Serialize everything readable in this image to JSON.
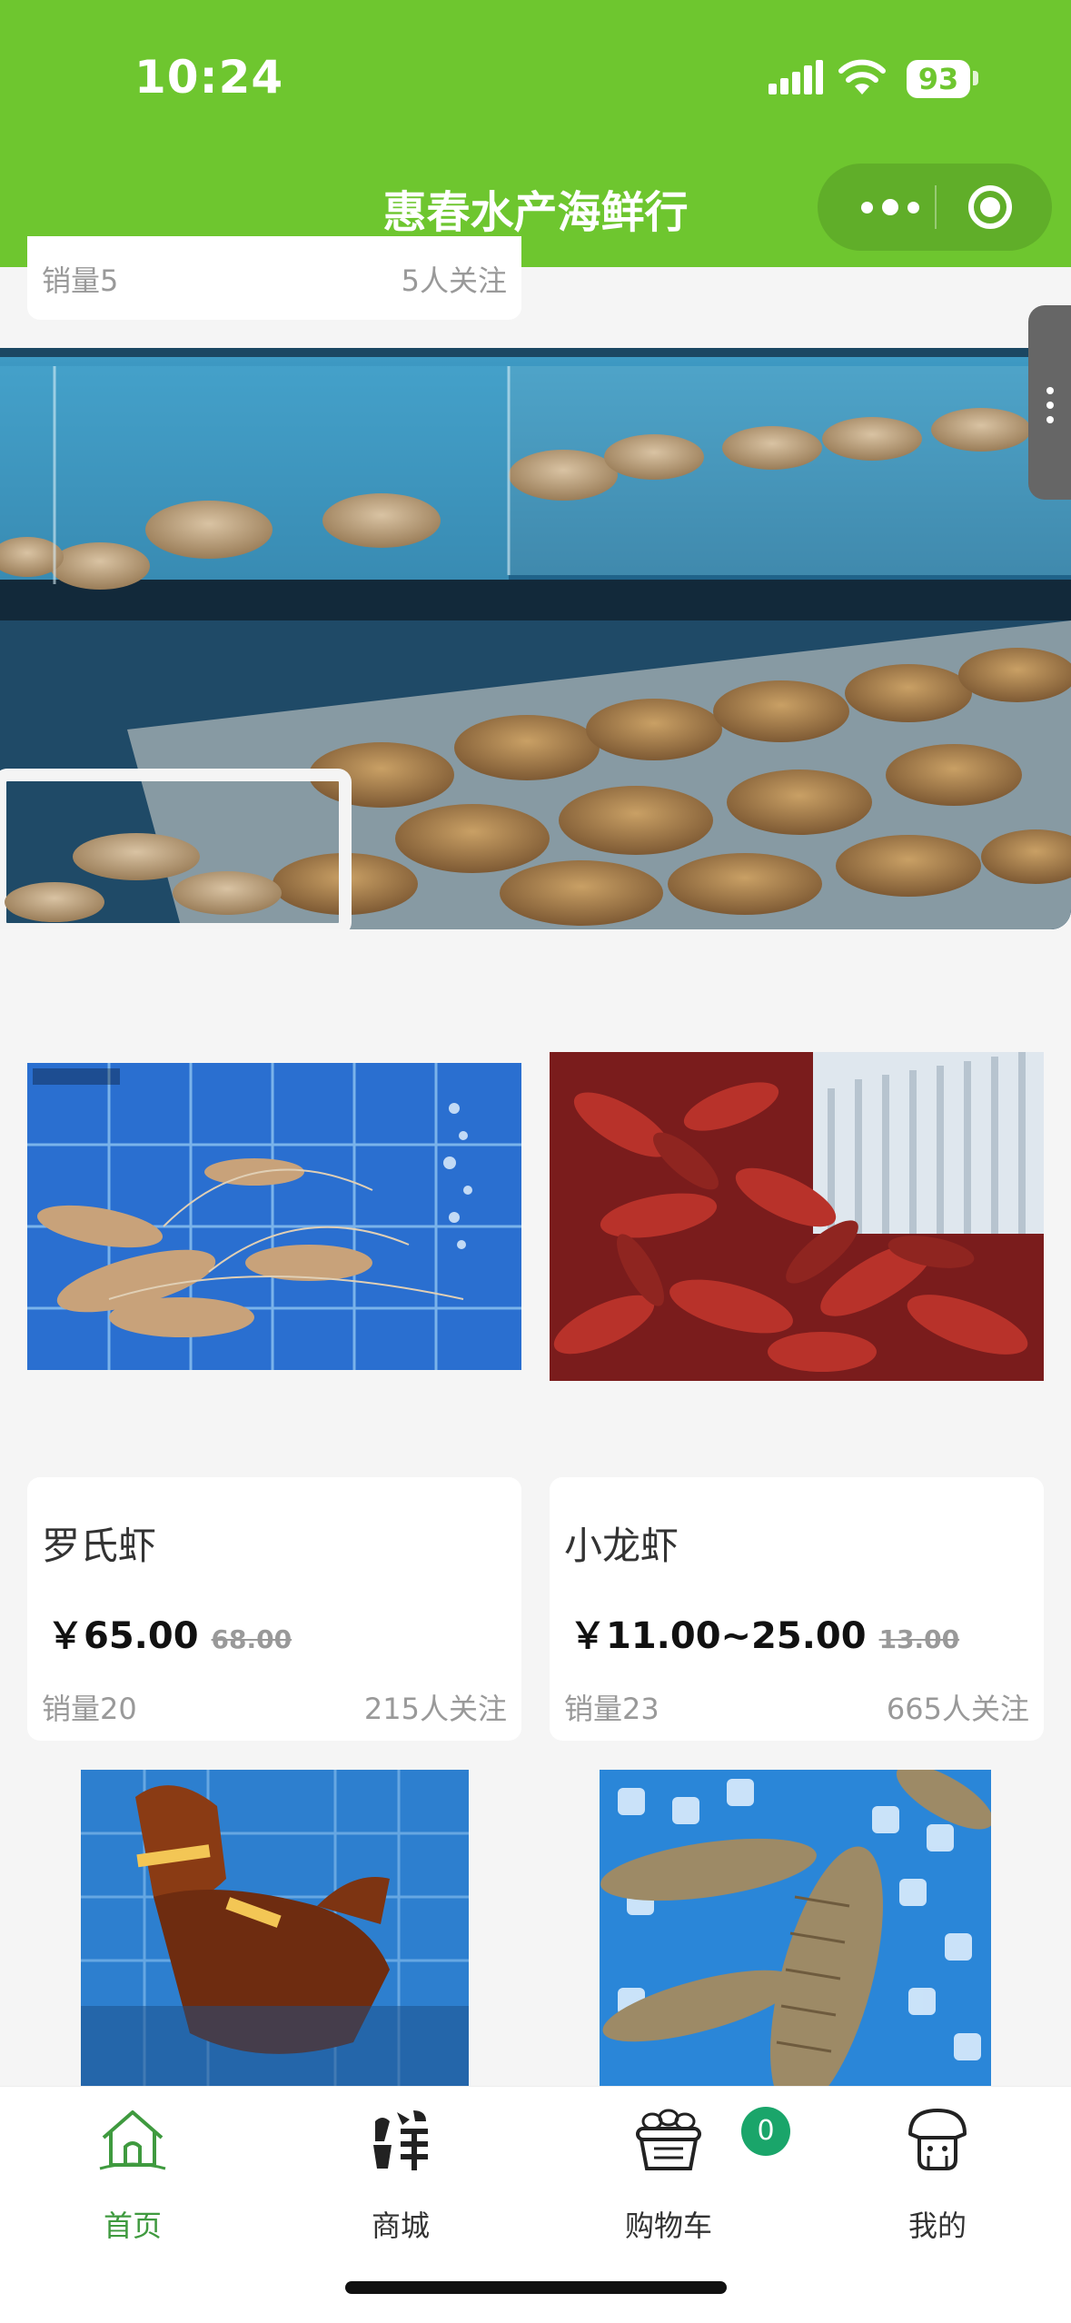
{
  "status_bar": {
    "time": "10:24",
    "battery": "93"
  },
  "header": {
    "title": "惠春水产海鲜行"
  },
  "partial_card": {
    "sales": "销量5",
    "follows": "5人关注"
  },
  "products": [
    {
      "name": "罗氏虾",
      "price": "￥65.00",
      "original_price": "68.00",
      "sales": "销量20",
      "follows": "215人关注"
    },
    {
      "name": "小龙虾",
      "price": "￥11.00~25.00",
      "original_price": "13.00",
      "sales": "销量23",
      "follows": "665人关注"
    }
  ],
  "tabbar": {
    "items": [
      {
        "label": "首页",
        "icon": "home-icon"
      },
      {
        "label": "商城",
        "icon": "fresh-shop-icon"
      },
      {
        "label": "购物车",
        "icon": "basket-icon"
      },
      {
        "label": "我的",
        "icon": "user-icon"
      }
    ],
    "cart_count": "0"
  },
  "colors": {
    "theme_green": "#6ec62f",
    "active_tab": "#3f9a3f",
    "badge": "#1aa56a"
  }
}
